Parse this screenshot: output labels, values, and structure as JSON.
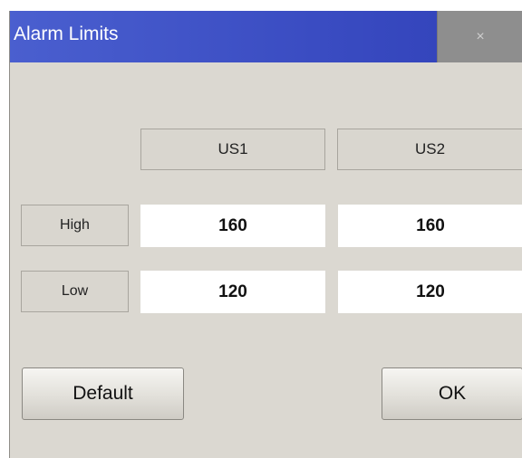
{
  "window": {
    "title": "Alarm Limits",
    "close_label": "×"
  },
  "columns": [
    "US1",
    "US2"
  ],
  "rows": [
    {
      "label": "High",
      "values": [
        "160",
        "160"
      ]
    },
    {
      "label": "Low",
      "values": [
        "120",
        "120"
      ]
    }
  ],
  "buttons": {
    "default_label": "Default",
    "ok_label": "OK"
  },
  "colors": {
    "titlebar": "#3a4cc2",
    "dialog_bg": "#dbd8d1"
  }
}
